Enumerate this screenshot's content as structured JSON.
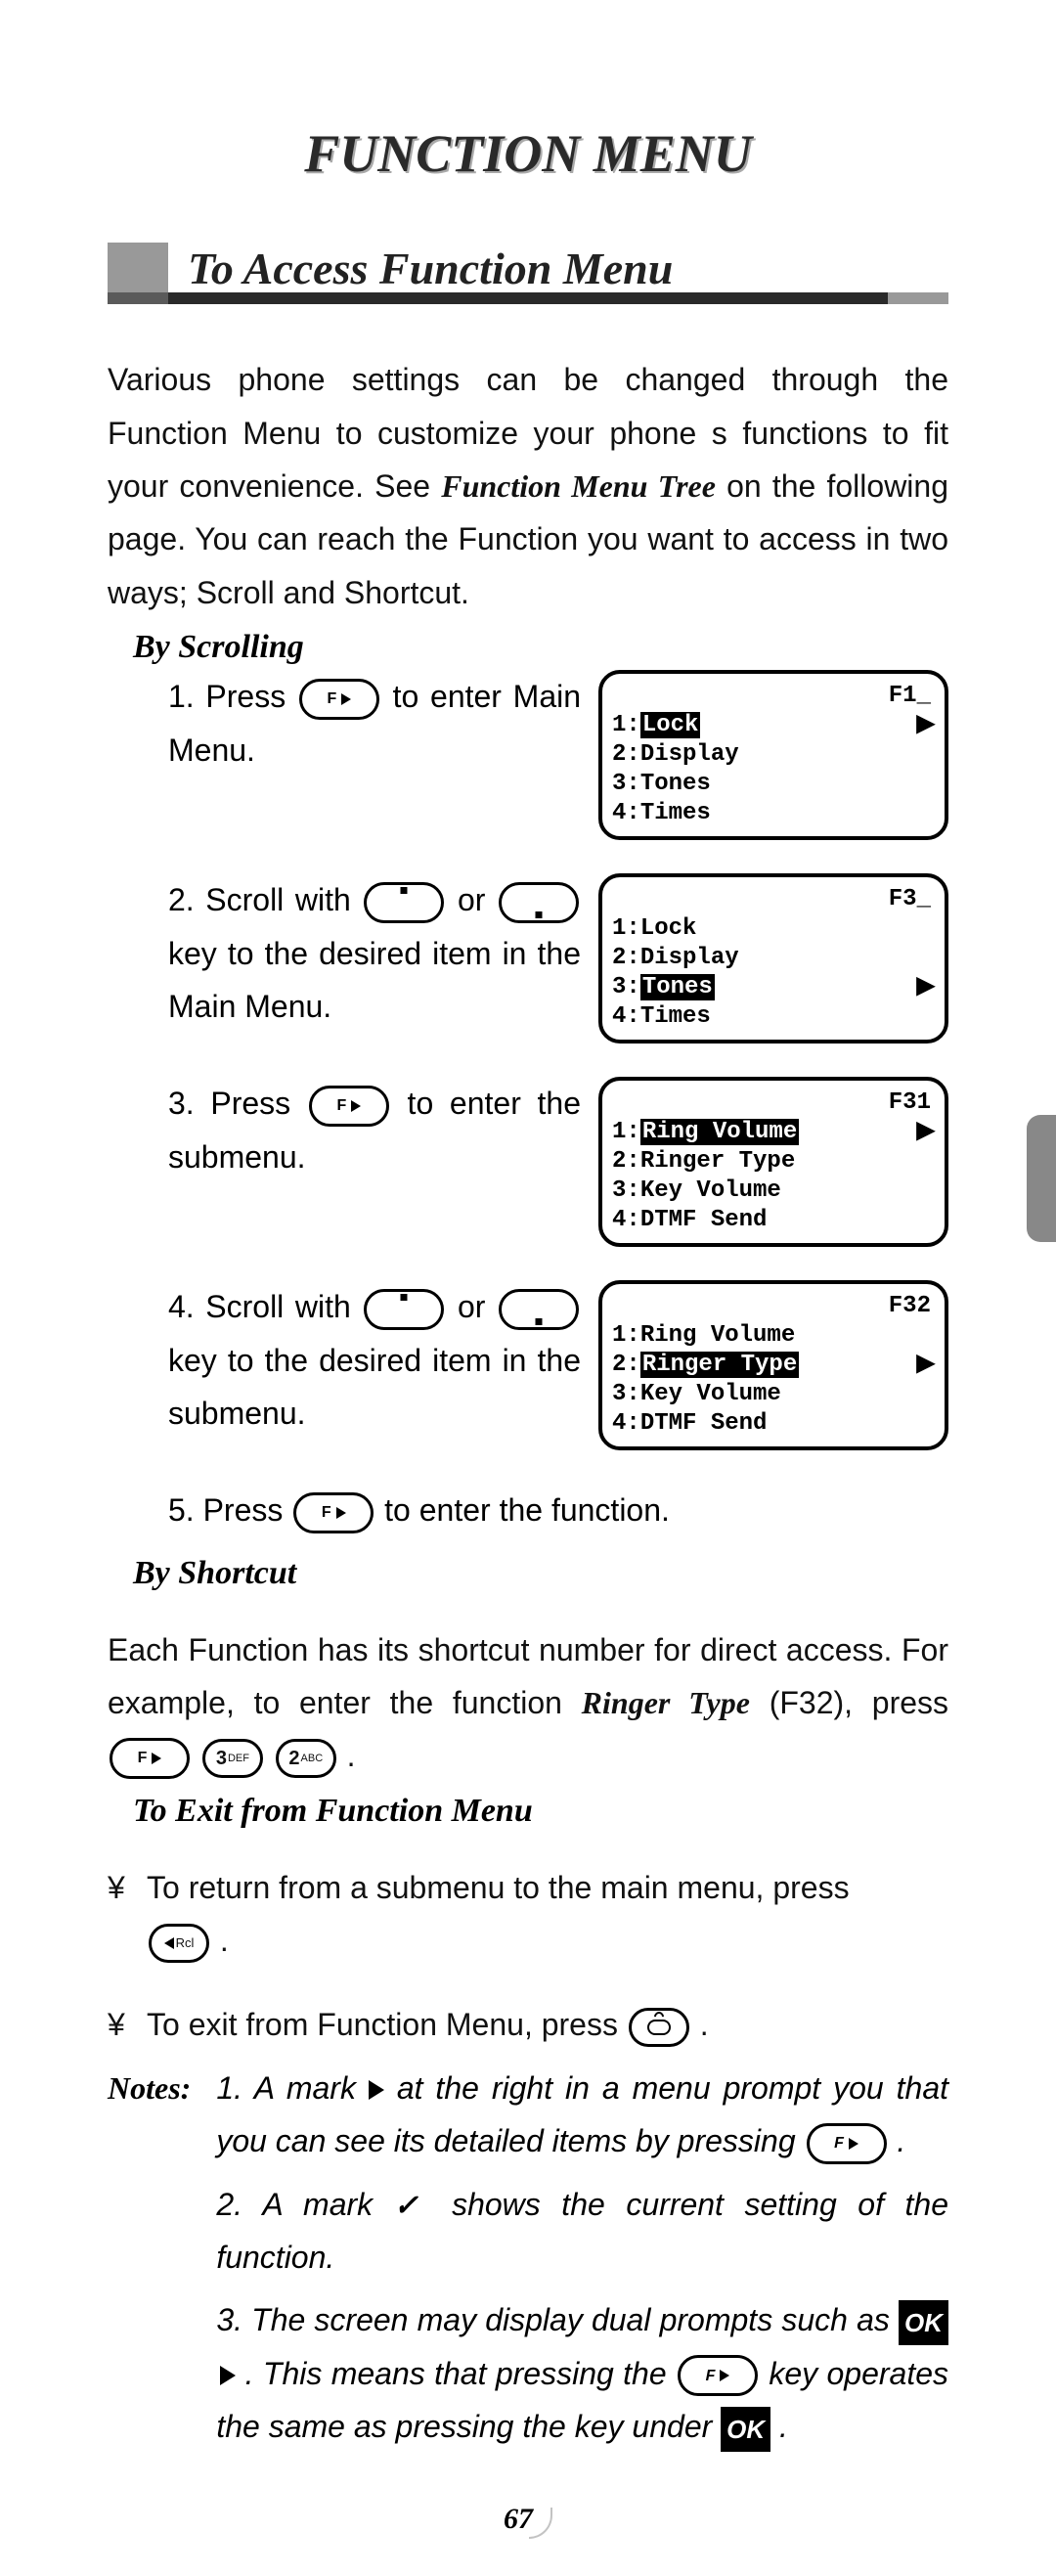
{
  "page_title": "FUNCTION MENU",
  "section_title": "To Access Function Menu",
  "intro_text_1": "Various phone settings can be changed through the Function Menu to customize your phone s functions to fit your convenience. See ",
  "intro_term": "Function Menu Tree",
  "intro_text_2": " on the following page. You can reach the Function you want to access in two ways; Scroll and Shortcut.",
  "by_scrolling": "By Scrolling",
  "steps": {
    "s1a": "1. Press ",
    "s1b": " to enter Main Menu.",
    "s2a": "2. Scroll with ",
    "s2or": " or ",
    "s2b": " key to the desired item in the Main Menu.",
    "s3a": "3. Press ",
    "s3b": " to enter the submenu.",
    "s4a": "4. Scroll with ",
    "s4b": " key to the desired item in the submenu.",
    "s5a": "5. Press ",
    "s5b": " to enter the function."
  },
  "screens": [
    {
      "code": "F1_",
      "items": [
        {
          "n": "1",
          "label": "Lock",
          "hl": true,
          "arrow": true
        },
        {
          "n": "2",
          "label": "Display"
        },
        {
          "n": "3",
          "label": "Tones"
        },
        {
          "n": "4",
          "label": "Times"
        }
      ]
    },
    {
      "code": "F3_",
      "items": [
        {
          "n": "1",
          "label": "Lock"
        },
        {
          "n": "2",
          "label": "Display"
        },
        {
          "n": "3",
          "label": "Tones",
          "hl": true,
          "arrow": true
        },
        {
          "n": "4",
          "label": "Times"
        }
      ]
    },
    {
      "code": "F31",
      "items": [
        {
          "n": "1",
          "label": "Ring Volume",
          "hl": true,
          "arrow": true
        },
        {
          "n": "2",
          "label": "Ringer Type"
        },
        {
          "n": "3",
          "label": "Key Volume"
        },
        {
          "n": "4",
          "label": "DTMF Send"
        }
      ]
    },
    {
      "code": "F32",
      "items": [
        {
          "n": "1",
          "label": "Ring Volume"
        },
        {
          "n": "2",
          "label": "Ringer Type",
          "hl": true,
          "arrow": true
        },
        {
          "n": "3",
          "label": "Key Volume"
        },
        {
          "n": "4",
          "label": "DTMF Send"
        }
      ]
    }
  ],
  "by_shortcut": "By Shortcut",
  "shortcut_1": "Each Function has its shortcut number for direct ac­cess. For example, to enter the function ",
  "shortcut_term": "Ringer Type",
  "shortcut_2": " (F32), press ",
  "key3_num": "3",
  "key3_sub": "DEF",
  "key2_num": "2",
  "key2_sub": "ABC",
  "to_exit": "To Exit from Function Menu",
  "exit_1": "To return from a submenu to the main menu, press ",
  "rcl": "Rcl",
  "exit_2": "To exit from Function Menu, press ",
  "notes_label": "Notes:",
  "notes": {
    "n1a": "1. A mark ",
    "n1b": " at the right in a menu prompt you that you can see its detailed items by pressing ",
    "n2a": "2. A mark ",
    "check": "✓",
    "n2b": " shows the current setting of the function.",
    "n3a": "3. The screen may display dual prompts such as ",
    "ok": "OK",
    "n3b": ". This means that pressing the ",
    "n3c": " key operates the same as pressing the key under ",
    "n3d": "."
  },
  "page_number": "67",
  "key_f": "F"
}
